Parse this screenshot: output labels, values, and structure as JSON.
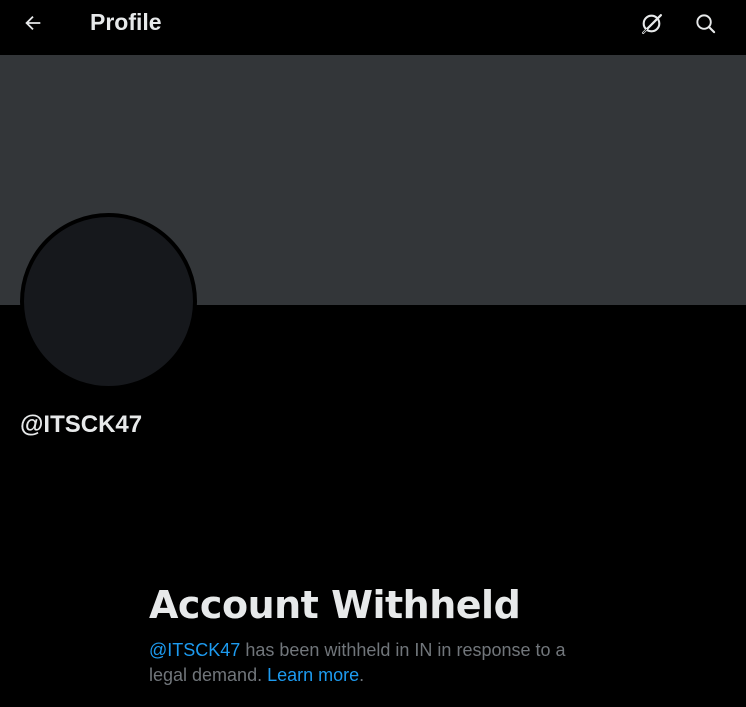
{
  "header": {
    "title": "Profile",
    "back_icon": "arrow-left-icon",
    "grok_icon": "grok-icon",
    "search_icon": "search-icon"
  },
  "profile": {
    "handle": "@ITSCK47"
  },
  "withheld": {
    "title": "Account Withheld",
    "mention": "@ITSCK47",
    "message": " has been withheld in IN in response to a legal demand. ",
    "learn_more": "Learn more",
    "period": "."
  },
  "colors": {
    "background": "#000000",
    "banner": "#333639",
    "avatar": "#16181c",
    "text": "#e7e9ea",
    "secondary_text": "#71767b",
    "link": "#1d9bf0"
  }
}
